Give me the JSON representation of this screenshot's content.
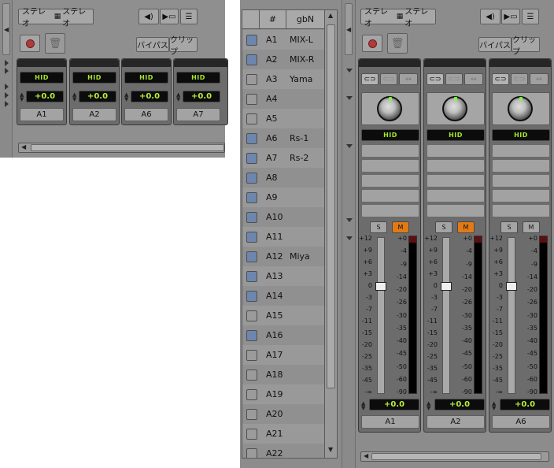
{
  "left_panel": {
    "toolbar": {
      "stereo1": "ステレオ",
      "stereo2": "ステレオ"
    },
    "bypass_label": "バイパス",
    "clip_label": "クリップ",
    "strips": [
      {
        "hid": "HID",
        "volume": "+0.0",
        "name": "A1"
      },
      {
        "hid": "HID",
        "volume": "+0.0",
        "name": "A2"
      },
      {
        "hid": "HID",
        "volume": "+0.0",
        "name": "A6"
      },
      {
        "hid": "HID",
        "volume": "+0.0",
        "name": "A7"
      }
    ]
  },
  "track_list": {
    "col_num": "#",
    "col_name": "gbN",
    "rows": [
      {
        "track": "A1",
        "name": "MIX-L",
        "checked": true
      },
      {
        "track": "A2",
        "name": "MIX-R",
        "checked": true
      },
      {
        "track": "A3",
        "name": "Yama",
        "checked": false
      },
      {
        "track": "A4",
        "name": "",
        "checked": false
      },
      {
        "track": "A5",
        "name": "",
        "checked": false
      },
      {
        "track": "A6",
        "name": "Rs-1",
        "checked": true
      },
      {
        "track": "A7",
        "name": "Rs-2",
        "checked": true
      },
      {
        "track": "A8",
        "name": "",
        "checked": true
      },
      {
        "track": "A9",
        "name": "",
        "checked": true
      },
      {
        "track": "A10",
        "name": "",
        "checked": true
      },
      {
        "track": "A11",
        "name": "",
        "checked": true
      },
      {
        "track": "A12",
        "name": "Miya",
        "checked": true
      },
      {
        "track": "A13",
        "name": "",
        "checked": true
      },
      {
        "track": "A14",
        "name": "",
        "checked": true
      },
      {
        "track": "A15",
        "name": "",
        "checked": false
      },
      {
        "track": "A16",
        "name": "",
        "checked": true
      },
      {
        "track": "A17",
        "name": "",
        "checked": false
      },
      {
        "track": "A18",
        "name": "",
        "checked": false
      },
      {
        "track": "A19",
        "name": "",
        "checked": false
      },
      {
        "track": "A20",
        "name": "",
        "checked": false
      },
      {
        "track": "A21",
        "name": "",
        "checked": false
      },
      {
        "track": "A22",
        "name": "",
        "checked": false
      }
    ]
  },
  "right_panel": {
    "toolbar": {
      "stereo1": "ステレオ",
      "stereo2": "ステレオ"
    },
    "bypass_label": "バイパス",
    "clip_label": "クリップ",
    "solo_label": "S",
    "mute_label": "M",
    "fader_scale": [
      "+12",
      "+9",
      "+6",
      "+3",
      "0",
      "-3",
      "-7",
      "-11",
      "-15",
      "-20",
      "-25",
      "-35",
      "-45",
      "-∞"
    ],
    "meter_scale": [
      "+0",
      "-4",
      "-9",
      "-14",
      "-20",
      "-26",
      "-30",
      "-35",
      "-40",
      "-45",
      "-50",
      "-60",
      "-90"
    ],
    "strips": [
      {
        "hid": "HID",
        "volume": "+0.0",
        "name": "A1",
        "muted": true
      },
      {
        "hid": "HID",
        "volume": "+0.0",
        "name": "A2",
        "muted": true
      },
      {
        "hid": "HID",
        "volume": "+0.0",
        "name": "A6",
        "muted": false
      }
    ]
  },
  "colors": {
    "checked": "#6d86ad",
    "unchecked": "#9b9b9b",
    "mute_on": "#e07a16",
    "lcd_text": "#b9f03a",
    "row_a": "#909090",
    "row_b": "#999999"
  }
}
